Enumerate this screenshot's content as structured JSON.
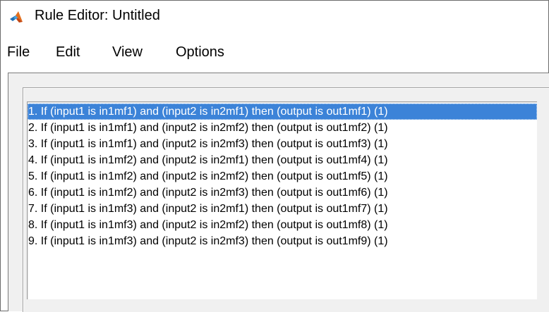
{
  "window": {
    "title": "Rule Editor: Untitled",
    "icon": "matlab-icon"
  },
  "menu": {
    "items": [
      {
        "label": "File"
      },
      {
        "label": "Edit"
      },
      {
        "label": "View"
      },
      {
        "label": "Options"
      }
    ]
  },
  "rules": {
    "selected_index": 0,
    "selected_color": "#3c83d8",
    "items": [
      {
        "text": "1. If (input1 is in1mf1) and (input2 is in2mf1) then (output is out1mf1) (1)"
      },
      {
        "text": "2. If (input1 is in1mf1) and (input2 is in2mf2) then (output is out1mf2) (1)"
      },
      {
        "text": "3. If (input1 is in1mf1) and (input2 is in2mf3) then (output is out1mf3) (1)"
      },
      {
        "text": "4. If (input1 is in1mf2) and (input2 is in2mf1) then (output is out1mf4) (1)"
      },
      {
        "text": "5. If (input1 is in1mf2) and (input2 is in2mf2) then (output is out1mf5) (1)"
      },
      {
        "text": "6. If (input1 is in1mf2) and (input2 is in2mf3) then (output is out1mf6) (1)"
      },
      {
        "text": "7. If (input1 is in1mf3) and (input2 is in2mf1) then (output is out1mf7) (1)"
      },
      {
        "text": "8. If (input1 is in1mf3) and (input2 is in2mf2) then (output is out1mf8) (1)"
      },
      {
        "text": "9. If (input1 is in1mf3) and (input2 is in2mf3) then (output is out1mf9) (1)"
      }
    ]
  }
}
